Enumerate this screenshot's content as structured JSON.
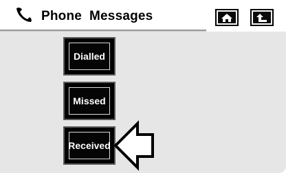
{
  "header": {
    "title": "Phone  Messages",
    "icon": "phone-handset-icon"
  },
  "nav": {
    "home_icon": "home-icon",
    "back_icon": "back-arrow-icon"
  },
  "menu": {
    "items": [
      {
        "label": "Dialled"
      },
      {
        "label": "Missed"
      },
      {
        "label": "Received"
      }
    ]
  },
  "pointer": {
    "icon": "pointer-arrow-icon",
    "target": "Received"
  },
  "colors": {
    "background": "#e6e6e6",
    "button_fill": "#000000",
    "button_text": "#ffffff"
  }
}
